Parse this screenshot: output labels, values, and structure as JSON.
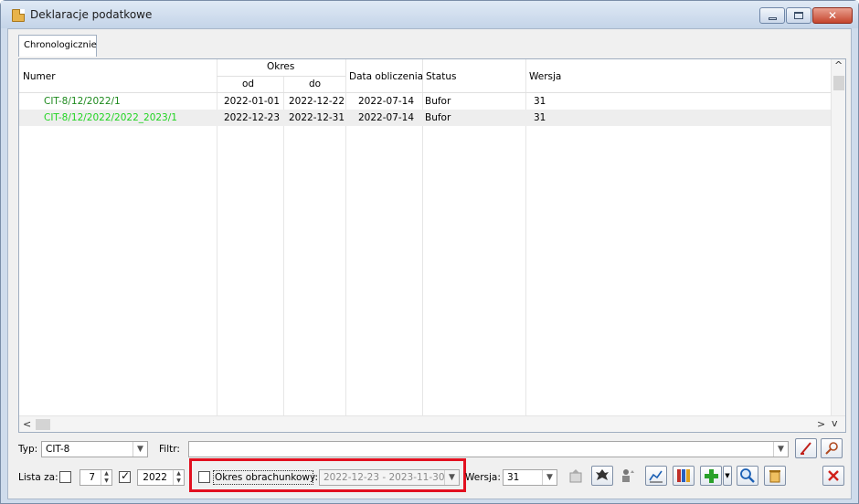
{
  "window": {
    "title": "Deklaracje podatkowe"
  },
  "tabs": [
    {
      "label": "Chronologicznie"
    }
  ],
  "grid": {
    "headers": {
      "numer": "Numer",
      "okres": "Okres",
      "od": "od",
      "do": "do",
      "data": "Data obliczenia",
      "status": "Status",
      "wersja": "Wersja"
    },
    "rows": [
      {
        "numer": "CIT-8/12/2022/1",
        "od": "2022-01-01",
        "do": "2022-12-22",
        "data": "2022-07-14",
        "status": "Bufor",
        "wersja": "31",
        "color": "#1e8a1e"
      },
      {
        "numer": "CIT-8/12/2022/2022_2023/1",
        "od": "2022-12-23",
        "do": "2022-12-31",
        "data": "2022-07-14",
        "status": "Bufor",
        "wersja": "31",
        "color": "#20d420"
      }
    ]
  },
  "filters": {
    "typ_label": "Typ:",
    "typ_value": "CIT-8",
    "filtr_label": "Filtr:",
    "filtr_value": "",
    "lista_label": "Lista za:",
    "lista_checked": false,
    "month_value": "7",
    "year_checked": true,
    "year_value": "2022",
    "okres_checked": false,
    "okres_label": "Okres obrachunkowy:",
    "okres_value": "2022-12-23 - 2023-11-30",
    "wersja_label": "Wersja:",
    "wersja_value": "31"
  },
  "colors": {
    "highlight": "#e2101f",
    "green_dark": "#1e8a1e",
    "green_bright": "#20d420"
  }
}
